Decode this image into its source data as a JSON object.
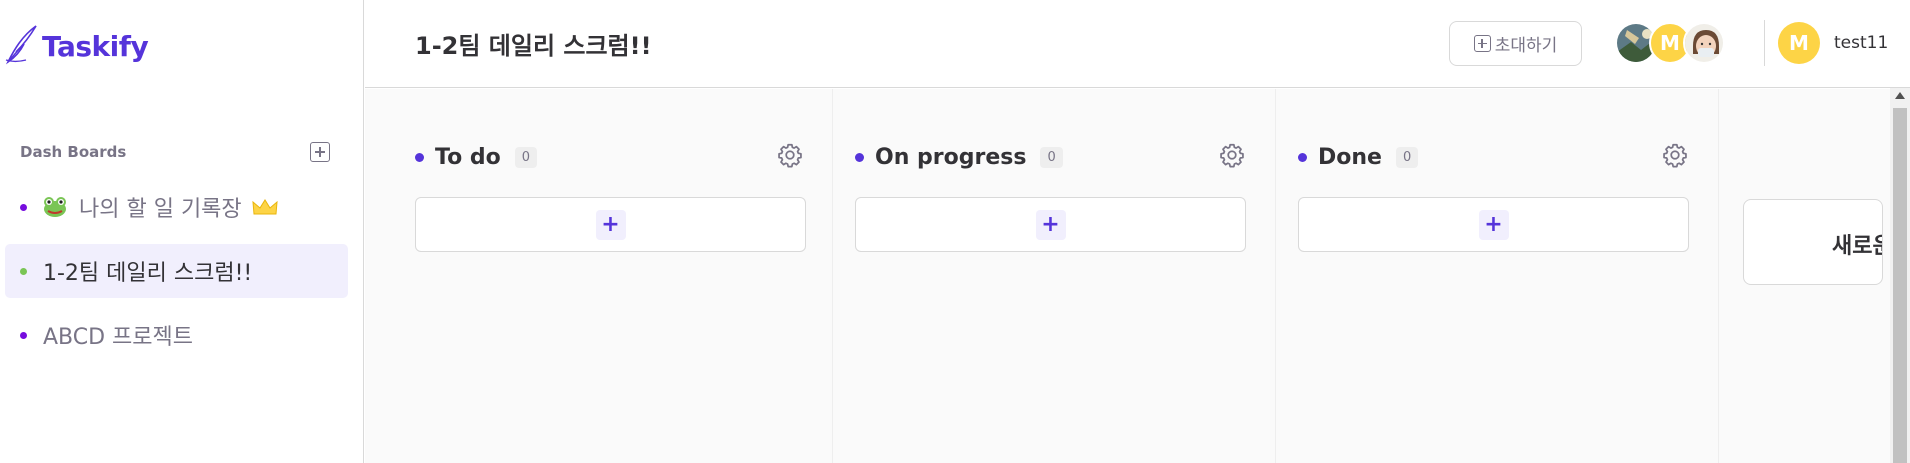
{
  "app": {
    "name": "Taskify",
    "brand_color": "#5534da"
  },
  "sidebar": {
    "section_title": "Dash Boards",
    "add_icon": "plus-square-icon",
    "items": [
      {
        "label": "🐸 나의 할 일 기록장",
        "text": "나의 할 일 기록장",
        "dot_color": "#7ac555",
        "owner": true,
        "active": false
      },
      {
        "label": "1-2팀 데일리 스크럼!!",
        "text": "1-2팀 데일리 스크럼!!",
        "dot_color": "#7ac555",
        "owner": false,
        "active": true
      },
      {
        "label": "ABCD 프로젝트",
        "text": "ABCD 프로젝트",
        "dot_color": "#760dde",
        "owner": false,
        "active": false
      }
    ]
  },
  "header": {
    "title": "1-2팀 데일리 스크럼!!",
    "invite_label": "초대하기",
    "members": [
      {
        "type": "photo",
        "name": "member-1"
      },
      {
        "type": "letter",
        "letter": "M"
      },
      {
        "type": "photo",
        "name": "member-3"
      }
    ],
    "user": {
      "initial": "M",
      "name": "test11"
    }
  },
  "columns": [
    {
      "title": "To do",
      "count": "0"
    },
    {
      "title": "On progress",
      "count": "0"
    },
    {
      "title": "Done",
      "count": "0"
    }
  ],
  "add_column": {
    "label": "새로운 컬럼 추가하기"
  },
  "icons": {
    "settings": "gear-icon",
    "add_card": "plus-icon",
    "crown": "crown-icon"
  }
}
